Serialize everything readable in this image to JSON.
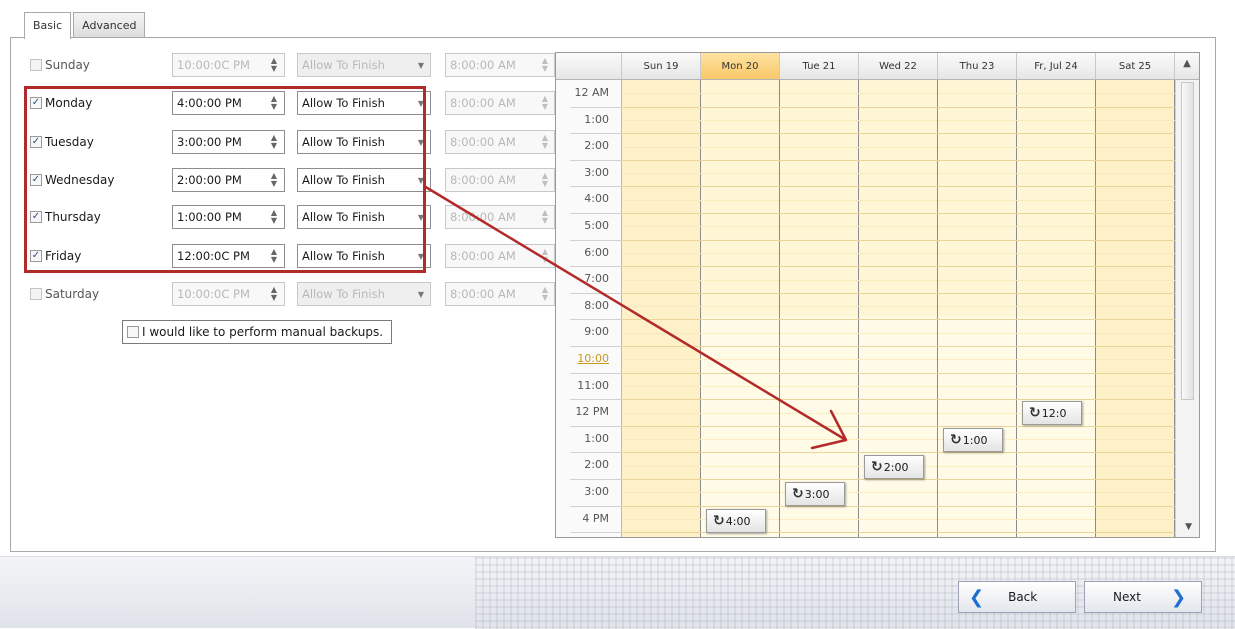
{
  "tabs": [
    "Basic",
    "Advanced"
  ],
  "schedule": [
    {
      "day": "Sunday",
      "checked": false,
      "time": "10:00:0C PM",
      "mode": "Allow To Finish",
      "end": "8:00:00 AM"
    },
    {
      "day": "Monday",
      "checked": true,
      "time": "4:00:00 PM",
      "mode": "Allow To Finish",
      "end": "8:00:00 AM"
    },
    {
      "day": "Tuesday",
      "checked": true,
      "time": "3:00:00 PM",
      "mode": "Allow To Finish",
      "end": "8:00:00 AM"
    },
    {
      "day": "Wednesday",
      "checked": true,
      "time": "2:00:00 PM",
      "mode": "Allow To Finish",
      "end": "8:00:00 AM"
    },
    {
      "day": "Thursday",
      "checked": true,
      "time": "1:00:00 PM",
      "mode": "Allow To Finish",
      "end": "8:00:00 AM"
    },
    {
      "day": "Friday",
      "checked": true,
      "time": "12:00:0C PM",
      "mode": "Allow To Finish",
      "end": "8:00:00 AM"
    },
    {
      "day": "Saturday",
      "checked": false,
      "time": "10:00:0C PM",
      "mode": "Allow To Finish",
      "end": "8:00:00 AM"
    }
  ],
  "manual_backup_label": "I would like to perform manual backups.",
  "calendar": {
    "days": [
      "Sun 19",
      "Mon 20",
      "Tue 21",
      "Wed 22",
      "Thu 23",
      "Fr, Jul 24",
      "Sat 25"
    ],
    "today_index": 1,
    "hours": [
      "12 AM",
      "1:00",
      "2:00",
      "3:00",
      "4:00",
      "5:00",
      "6:00",
      "7:00",
      "8:00",
      "9:00",
      "10:00",
      "11:00",
      "12 PM",
      "1:00",
      "2:00",
      "3:00",
      "4 PM"
    ],
    "current_hour_index": 10,
    "appointments": [
      {
        "day_index": 1,
        "label": "4:00"
      },
      {
        "day_index": 2,
        "label": "3:00"
      },
      {
        "day_index": 3,
        "label": "2:00"
      },
      {
        "day_index": 4,
        "label": "1:00"
      },
      {
        "day_index": 5,
        "label": "12:0"
      }
    ]
  },
  "footer": {
    "back_label": "Back",
    "next_label": "Next"
  },
  "colors": {
    "highlight": "#b22a2a",
    "accent": "#1d6fd0",
    "today": "#f9c868"
  }
}
